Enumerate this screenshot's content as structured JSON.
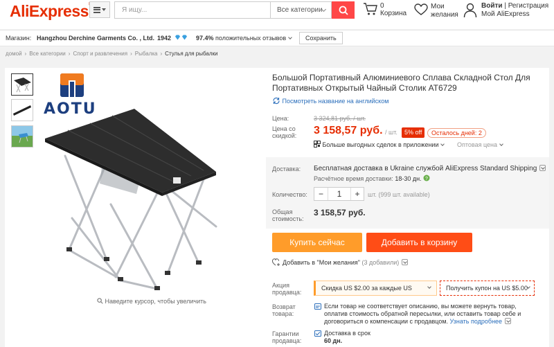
{
  "header": {
    "logo": "AliExpress",
    "logo_mark": "®",
    "search_placeholder": "Я ищу...",
    "category_select": "Все категории",
    "cart_count": "0",
    "cart_label": "Корзина",
    "wishlist_label_1": "Мои",
    "wishlist_label_2": "желания",
    "login": "Войти",
    "separator": "|",
    "register": "Регистрация",
    "my_ali": "Мой AliExpress"
  },
  "store": {
    "label": "Магазин:",
    "name": "Hangzhou Derchine Garments Co. , Ltd.",
    "score": "1942",
    "positive_pct": "97.4%",
    "positive_label": "положительных отзывов",
    "save_button": "Сохранить"
  },
  "breadcrumb": [
    "домой",
    "Все категории",
    "Спорт и развлечения",
    "Рыбалка",
    "Стулья для рыбалки"
  ],
  "breadcrumb_sep": "›",
  "gallery": {
    "brand_text": "AOTU",
    "zoom_hint": "Наведите курсор, чтобы увеличить"
  },
  "product": {
    "title": "Большой Портативный Алюминиевого Сплава Складной Стол Для Портативных Открытый Чайный Столик AT6729",
    "translate_link": "Посмотреть название на английском",
    "price_label": "Цена:",
    "old_price": "3 324,81 руб. / шт.",
    "discount_label": "Цена со скидкой:",
    "price": "3 158,57 руб.",
    "per_unit": "/ шт.",
    "discount_badge": "5% off",
    "days_left": "Осталось дней: 2",
    "app_deals": "Больше выгодных сделок в приложении",
    "wholesale": "Оптовая цена",
    "delivery_label": "Доставка:",
    "shipping": "Бесплатная доставка в Ukraine службой AliExpress Standard Shipping",
    "ship_time_label": "Расчётное время доставки:",
    "ship_time": "18-30 дн.",
    "qty_label": "Количество:",
    "qty_minus": "−",
    "qty_value": "1",
    "qty_plus": "+",
    "qty_available": "шт. (999 шт. available)",
    "total_label": "Общая стоимость:",
    "total": "3 158,57 руб.",
    "buy_now": "Купить сейчас",
    "add_to_cart": "Добавить в корзину",
    "add_wish": "Добавить в \"Мои желания\"",
    "wish_count": "(3 добавили)",
    "promo_label": "Акция продавца:",
    "coupon_discount": "Скидка US $2.00 за каждые US",
    "coupon_get": "Получить купон на US $5.00",
    "return_label": "Возврат товара:",
    "return_text": "Если товар не соответствует описанию, вы можете вернуть товар, оплатив стоимость обратной пересылки, или оставить товар себе и договориться о компенсации с продавцом.",
    "return_more": "Узнать подробнее",
    "guarantee_label": "Гарантии продавца:",
    "guarantee_line1": "Доставка в срок",
    "guarantee_line2": "60 дн."
  },
  "colors": {
    "brand": "#e62e04",
    "buy_now": "#ff9c2a",
    "add_to_cart": "#ff4d16",
    "link": "#2a6ebb"
  }
}
